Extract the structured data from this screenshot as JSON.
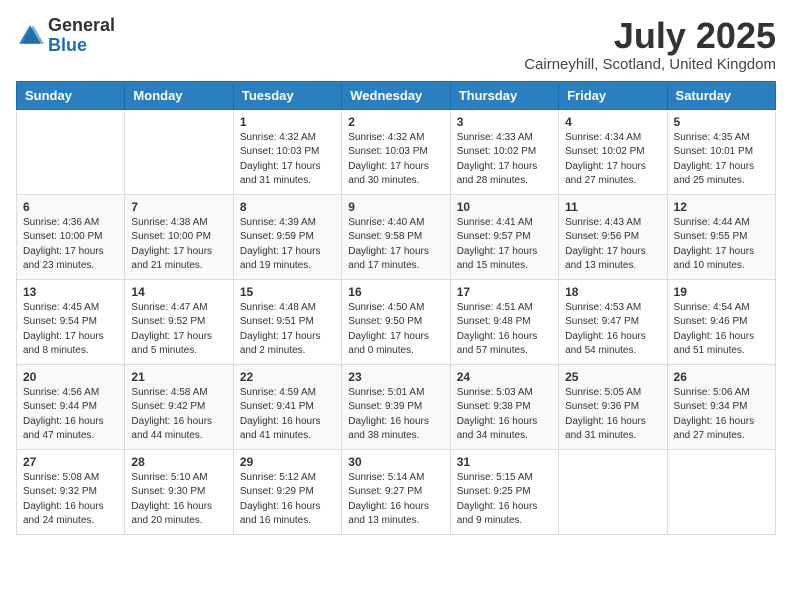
{
  "header": {
    "logo_general": "General",
    "logo_blue": "Blue",
    "month": "July 2025",
    "location": "Cairneyhill, Scotland, United Kingdom"
  },
  "weekdays": [
    "Sunday",
    "Monday",
    "Tuesday",
    "Wednesday",
    "Thursday",
    "Friday",
    "Saturday"
  ],
  "weeks": [
    [
      {
        "day": "",
        "sunrise": "",
        "sunset": "",
        "daylight": ""
      },
      {
        "day": "",
        "sunrise": "",
        "sunset": "",
        "daylight": ""
      },
      {
        "day": "1",
        "sunrise": "Sunrise: 4:32 AM",
        "sunset": "Sunset: 10:03 PM",
        "daylight": "Daylight: 17 hours and 31 minutes."
      },
      {
        "day": "2",
        "sunrise": "Sunrise: 4:32 AM",
        "sunset": "Sunset: 10:03 PM",
        "daylight": "Daylight: 17 hours and 30 minutes."
      },
      {
        "day": "3",
        "sunrise": "Sunrise: 4:33 AM",
        "sunset": "Sunset: 10:02 PM",
        "daylight": "Daylight: 17 hours and 28 minutes."
      },
      {
        "day": "4",
        "sunrise": "Sunrise: 4:34 AM",
        "sunset": "Sunset: 10:02 PM",
        "daylight": "Daylight: 17 hours and 27 minutes."
      },
      {
        "day": "5",
        "sunrise": "Sunrise: 4:35 AM",
        "sunset": "Sunset: 10:01 PM",
        "daylight": "Daylight: 17 hours and 25 minutes."
      }
    ],
    [
      {
        "day": "6",
        "sunrise": "Sunrise: 4:36 AM",
        "sunset": "Sunset: 10:00 PM",
        "daylight": "Daylight: 17 hours and 23 minutes."
      },
      {
        "day": "7",
        "sunrise": "Sunrise: 4:38 AM",
        "sunset": "Sunset: 10:00 PM",
        "daylight": "Daylight: 17 hours and 21 minutes."
      },
      {
        "day": "8",
        "sunrise": "Sunrise: 4:39 AM",
        "sunset": "Sunset: 9:59 PM",
        "daylight": "Daylight: 17 hours and 19 minutes."
      },
      {
        "day": "9",
        "sunrise": "Sunrise: 4:40 AM",
        "sunset": "Sunset: 9:58 PM",
        "daylight": "Daylight: 17 hours and 17 minutes."
      },
      {
        "day": "10",
        "sunrise": "Sunrise: 4:41 AM",
        "sunset": "Sunset: 9:57 PM",
        "daylight": "Daylight: 17 hours and 15 minutes."
      },
      {
        "day": "11",
        "sunrise": "Sunrise: 4:43 AM",
        "sunset": "Sunset: 9:56 PM",
        "daylight": "Daylight: 17 hours and 13 minutes."
      },
      {
        "day": "12",
        "sunrise": "Sunrise: 4:44 AM",
        "sunset": "Sunset: 9:55 PM",
        "daylight": "Daylight: 17 hours and 10 minutes."
      }
    ],
    [
      {
        "day": "13",
        "sunrise": "Sunrise: 4:45 AM",
        "sunset": "Sunset: 9:54 PM",
        "daylight": "Daylight: 17 hours and 8 minutes."
      },
      {
        "day": "14",
        "sunrise": "Sunrise: 4:47 AM",
        "sunset": "Sunset: 9:52 PM",
        "daylight": "Daylight: 17 hours and 5 minutes."
      },
      {
        "day": "15",
        "sunrise": "Sunrise: 4:48 AM",
        "sunset": "Sunset: 9:51 PM",
        "daylight": "Daylight: 17 hours and 2 minutes."
      },
      {
        "day": "16",
        "sunrise": "Sunrise: 4:50 AM",
        "sunset": "Sunset: 9:50 PM",
        "daylight": "Daylight: 17 hours and 0 minutes."
      },
      {
        "day": "17",
        "sunrise": "Sunrise: 4:51 AM",
        "sunset": "Sunset: 9:48 PM",
        "daylight": "Daylight: 16 hours and 57 minutes."
      },
      {
        "day": "18",
        "sunrise": "Sunrise: 4:53 AM",
        "sunset": "Sunset: 9:47 PM",
        "daylight": "Daylight: 16 hours and 54 minutes."
      },
      {
        "day": "19",
        "sunrise": "Sunrise: 4:54 AM",
        "sunset": "Sunset: 9:46 PM",
        "daylight": "Daylight: 16 hours and 51 minutes."
      }
    ],
    [
      {
        "day": "20",
        "sunrise": "Sunrise: 4:56 AM",
        "sunset": "Sunset: 9:44 PM",
        "daylight": "Daylight: 16 hours and 47 minutes."
      },
      {
        "day": "21",
        "sunrise": "Sunrise: 4:58 AM",
        "sunset": "Sunset: 9:42 PM",
        "daylight": "Daylight: 16 hours and 44 minutes."
      },
      {
        "day": "22",
        "sunrise": "Sunrise: 4:59 AM",
        "sunset": "Sunset: 9:41 PM",
        "daylight": "Daylight: 16 hours and 41 minutes."
      },
      {
        "day": "23",
        "sunrise": "Sunrise: 5:01 AM",
        "sunset": "Sunset: 9:39 PM",
        "daylight": "Daylight: 16 hours and 38 minutes."
      },
      {
        "day": "24",
        "sunrise": "Sunrise: 5:03 AM",
        "sunset": "Sunset: 9:38 PM",
        "daylight": "Daylight: 16 hours and 34 minutes."
      },
      {
        "day": "25",
        "sunrise": "Sunrise: 5:05 AM",
        "sunset": "Sunset: 9:36 PM",
        "daylight": "Daylight: 16 hours and 31 minutes."
      },
      {
        "day": "26",
        "sunrise": "Sunrise: 5:06 AM",
        "sunset": "Sunset: 9:34 PM",
        "daylight": "Daylight: 16 hours and 27 minutes."
      }
    ],
    [
      {
        "day": "27",
        "sunrise": "Sunrise: 5:08 AM",
        "sunset": "Sunset: 9:32 PM",
        "daylight": "Daylight: 16 hours and 24 minutes."
      },
      {
        "day": "28",
        "sunrise": "Sunrise: 5:10 AM",
        "sunset": "Sunset: 9:30 PM",
        "daylight": "Daylight: 16 hours and 20 minutes."
      },
      {
        "day": "29",
        "sunrise": "Sunrise: 5:12 AM",
        "sunset": "Sunset: 9:29 PM",
        "daylight": "Daylight: 16 hours and 16 minutes."
      },
      {
        "day": "30",
        "sunrise": "Sunrise: 5:14 AM",
        "sunset": "Sunset: 9:27 PM",
        "daylight": "Daylight: 16 hours and 13 minutes."
      },
      {
        "day": "31",
        "sunrise": "Sunrise: 5:15 AM",
        "sunset": "Sunset: 9:25 PM",
        "daylight": "Daylight: 16 hours and 9 minutes."
      },
      {
        "day": "",
        "sunrise": "",
        "sunset": "",
        "daylight": ""
      },
      {
        "day": "",
        "sunrise": "",
        "sunset": "",
        "daylight": ""
      }
    ]
  ]
}
